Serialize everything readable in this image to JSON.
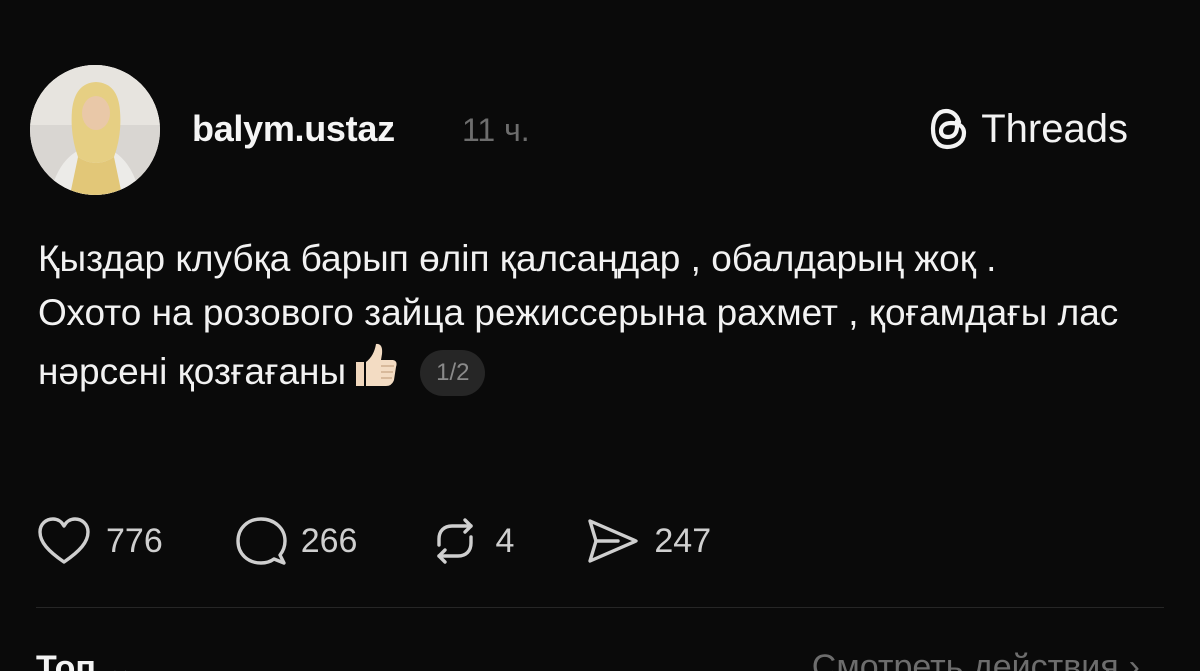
{
  "post": {
    "username": "balym.ustaz",
    "time": "11 ч.",
    "brand": "Threads",
    "lines": [
      "Қыздар клубқа барып өліп қалсаңдар , обалдарың жоқ .",
      "Охото на розового зайца режиссерына рахмет , қоғамдағы лас нәрсені қозғағаны"
    ],
    "emoji": "thumbs-up",
    "page_indicator": "1/2"
  },
  "actions": {
    "likes": "776",
    "comments": "266",
    "reposts": "4",
    "shares": "247"
  },
  "footer": {
    "sort_label": "Топ",
    "sort_chevron": "⌄",
    "view_activity": "Смотреть действия",
    "view_activity_chevron": "›"
  },
  "colors": {
    "background": "#0a0a0a",
    "text": "#f2f2f2",
    "muted": "#6d6d6d",
    "badge_bg": "#262626"
  },
  "icons": [
    "threads-logo-icon",
    "heart-icon",
    "comment-icon",
    "repost-icon",
    "share-icon",
    "chevron-down-icon",
    "chevron-right-icon"
  ]
}
